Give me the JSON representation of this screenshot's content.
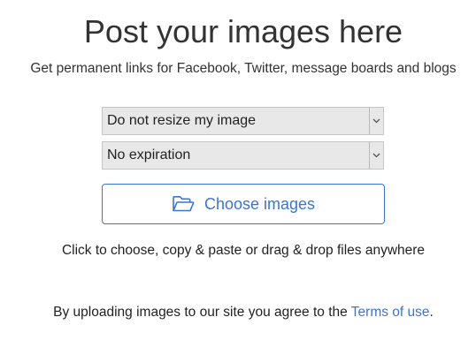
{
  "header": {
    "title": "Post your images here",
    "subtitle": "Get permanent links for Facebook, Twitter, message boards and blogs"
  },
  "form": {
    "resize_select": {
      "selected": "Do not resize my image",
      "icon": "chevron-down-icon"
    },
    "expiry_select": {
      "selected": "No expiration",
      "icon": "chevron-down-icon"
    },
    "choose_button": {
      "label": "Choose images",
      "icon": "folder-open-icon"
    }
  },
  "hint": {
    "text": "Click to choose, copy & paste or drag & drop files anywhere"
  },
  "agreement": {
    "prefix": "By uploading images to our site you agree to the ",
    "link_label": "Terms of use",
    "suffix": "."
  },
  "colors": {
    "accent": "#3b74d9",
    "text": "#333333",
    "select_bg": "#e8e8e8",
    "select_border": "#c6c6c6"
  }
}
